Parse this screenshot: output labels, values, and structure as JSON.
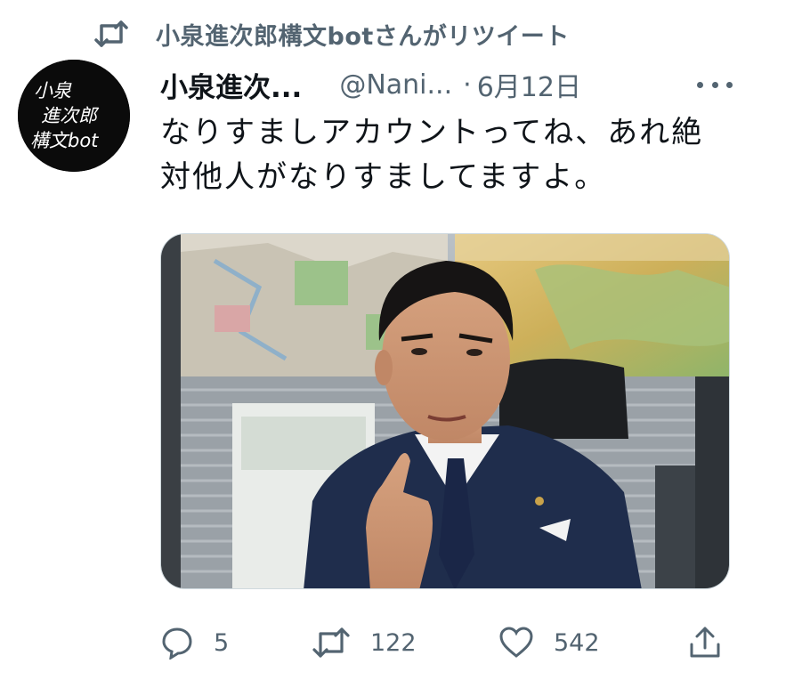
{
  "retweet_banner": {
    "text": "小泉進次郎構文botさんがリツイート",
    "icon": "retweet-icon"
  },
  "tweet": {
    "display_name": "小泉進次...",
    "handle": "@Nani...",
    "separator": "·",
    "date": "6月12日",
    "more_icon": "more-dots-icon",
    "avatar": {
      "text_line1": "小泉",
      "text_line2": "進次郎",
      "text_line3": "構文bot"
    },
    "text_lines": [
      "なりすましアカウントってね、あれ絶",
      "対他人がなりすましてますよ。"
    ],
    "media": {
      "kind": "photo",
      "subject": "man in suit gesturing in office with maps"
    }
  },
  "actions": {
    "reply": {
      "icon": "reply-icon",
      "count": "5"
    },
    "retweet": {
      "icon": "retweet-icon",
      "count": "122"
    },
    "like": {
      "icon": "heart-icon",
      "count": "542"
    },
    "share": {
      "icon": "share-icon"
    }
  },
  "colors": {
    "secondary_text": "#536471",
    "primary_text": "#0f1419",
    "background": "#ffffff"
  }
}
